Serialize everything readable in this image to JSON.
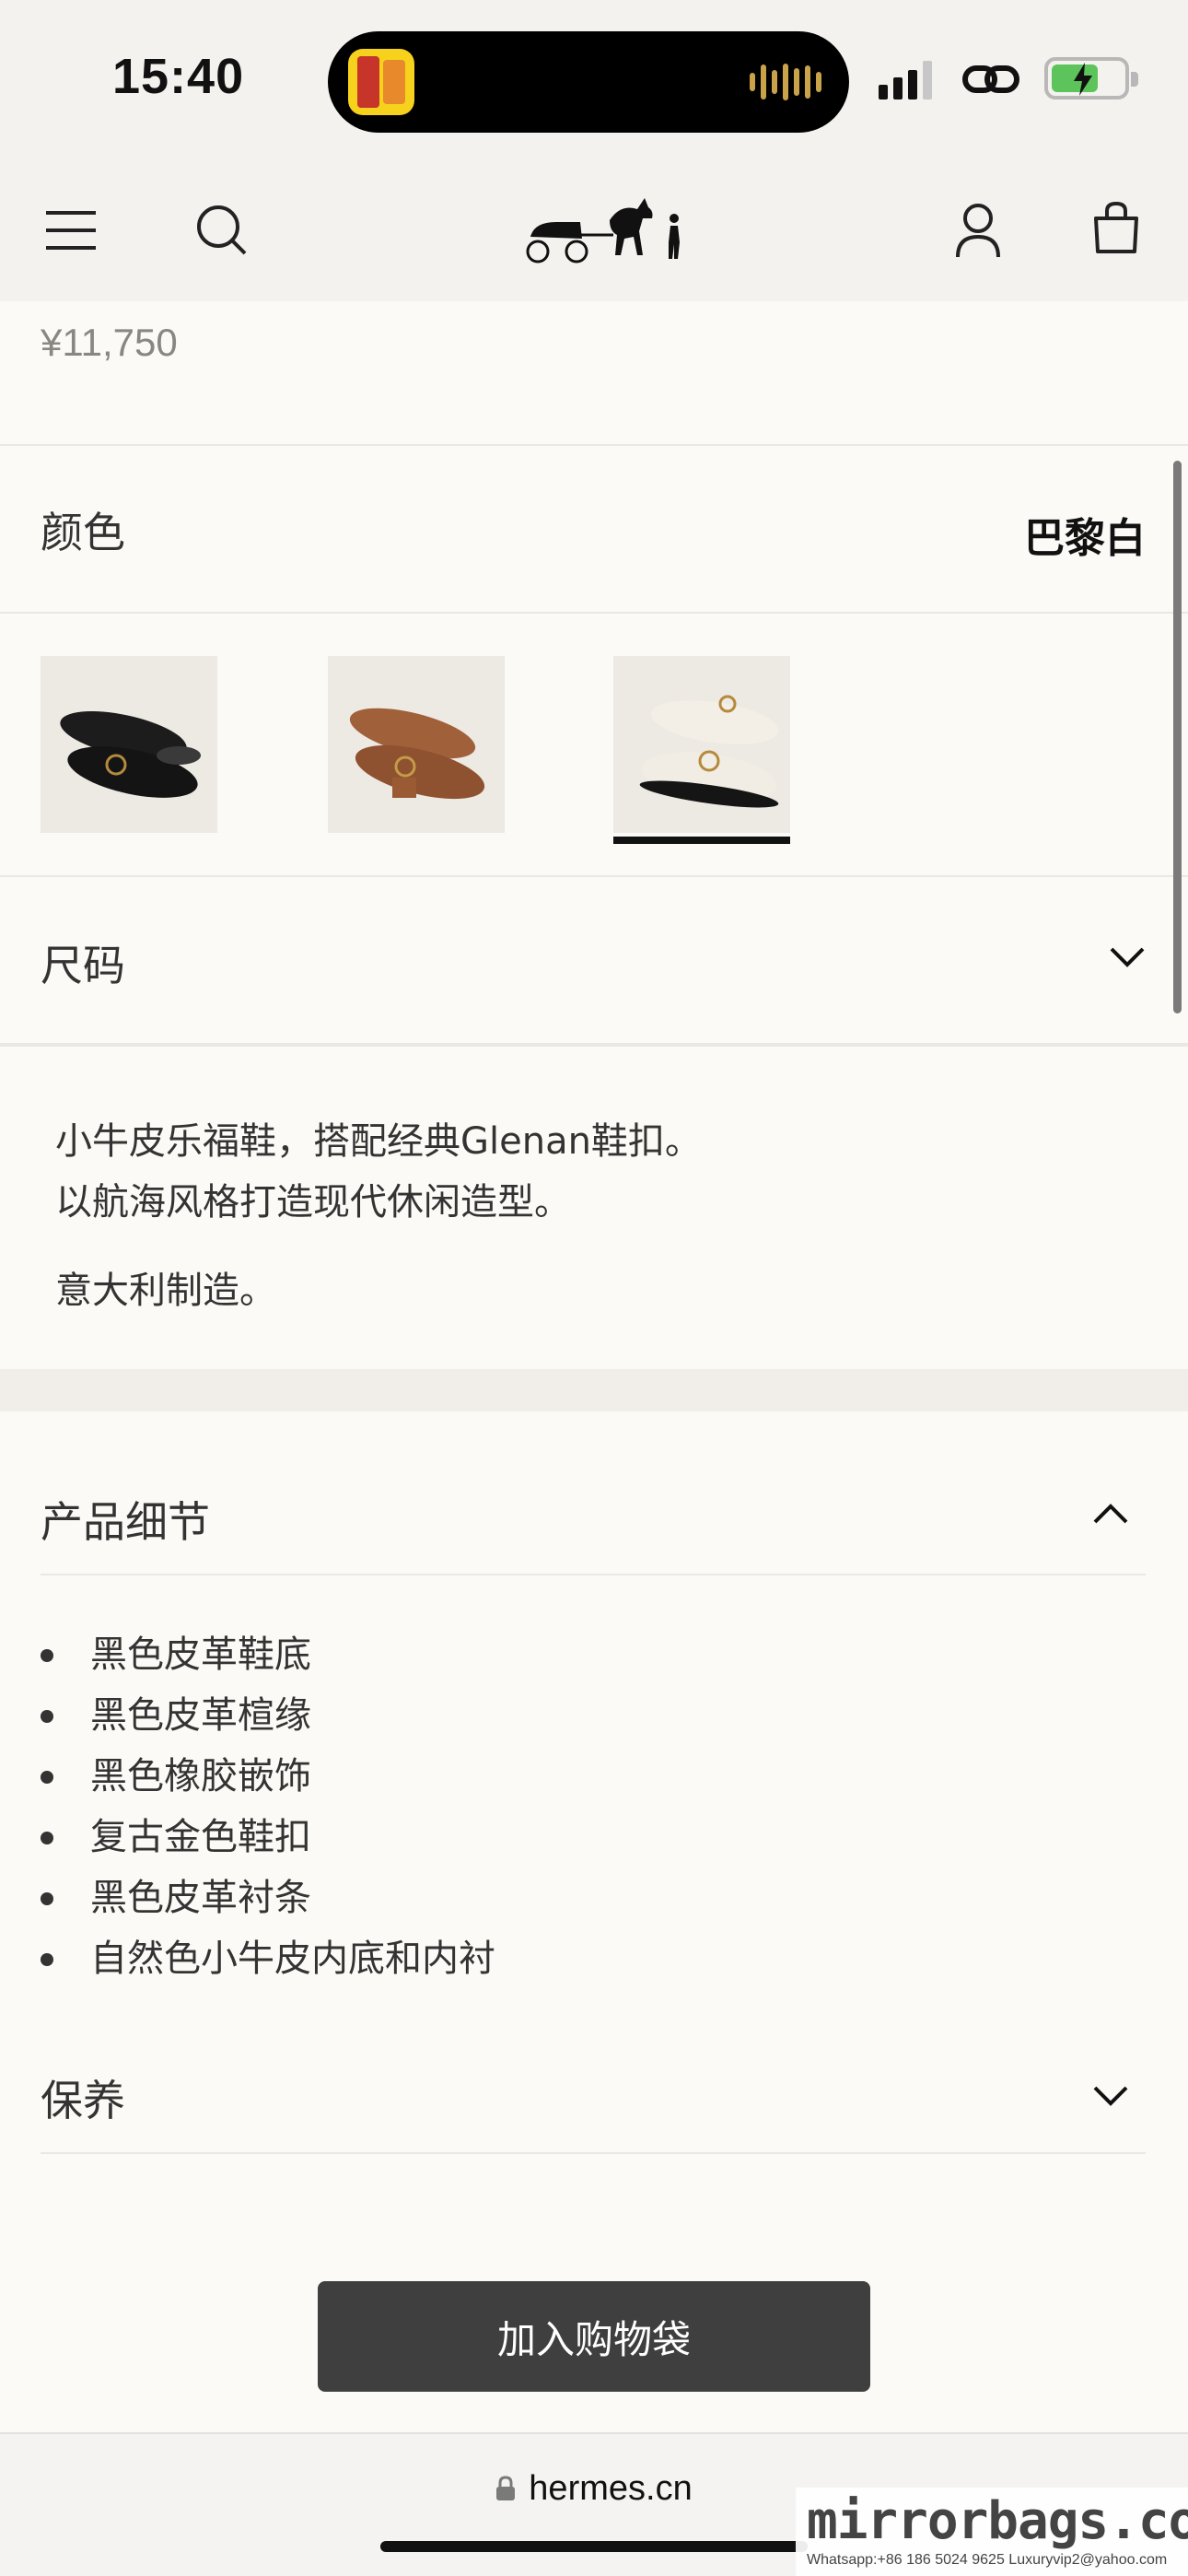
{
  "status_bar": {
    "time": "15:40",
    "island_app_icon": "live-activity-app-icon",
    "icons": [
      "cellular-signal-icon",
      "link-icon",
      "battery-charging-icon"
    ],
    "colors": {
      "battery": "#5cc45a",
      "waveform": "#c9a24a"
    }
  },
  "header": {
    "icons": [
      "menu-icon",
      "search-icon",
      "hermes-carriage-logo",
      "account-icon",
      "shopping-bag-icon"
    ]
  },
  "product": {
    "price": "¥11,750",
    "color_label": "颜色",
    "color_value": "巴黎白",
    "swatches": [
      {
        "name": "black",
        "color": "#1c1c1c",
        "selected": false
      },
      {
        "name": "brown",
        "color": "#a0603a",
        "selected": false
      },
      {
        "name": "white",
        "color": "#f1ede4",
        "selected": true
      }
    ],
    "size_label": "尺码"
  },
  "description": {
    "line1": "小牛皮乐福鞋，搭配经典Glenan鞋扣。",
    "line2": "以航海风格打造现代休闲造型。",
    "line3": "意大利制造。"
  },
  "details": {
    "title": "产品细节",
    "items": [
      "黑色皮革鞋底",
      "黑色皮革楦缘",
      "黑色橡胶嵌饰",
      "复古金色鞋扣",
      "黑色皮革衬条",
      "自然色小牛皮内底和内衬"
    ]
  },
  "care": {
    "title": "保养"
  },
  "cta": {
    "label": "加入购物袋",
    "color": "#3f3f3f"
  },
  "browser": {
    "url": "hermes.cn"
  },
  "watermark": {
    "brand": "mirrorbags.com",
    "contact": "Whatsapp:+86 186 5024 9625   Luxuryvip2@yahoo.com"
  }
}
